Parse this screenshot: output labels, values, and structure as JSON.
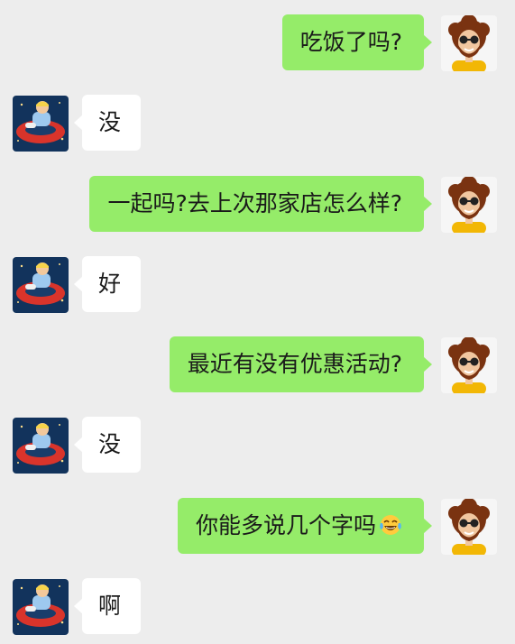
{
  "chat": {
    "messages": [
      {
        "sender": "me",
        "text": "吃饭了吗?"
      },
      {
        "sender": "friend",
        "text": "没"
      },
      {
        "sender": "me",
        "text": "一起吗?去上次那家店怎么样?"
      },
      {
        "sender": "friend",
        "text": "好"
      },
      {
        "sender": "me",
        "text": "最近有没有优惠活动?"
      },
      {
        "sender": "friend",
        "text": "没"
      },
      {
        "sender": "me",
        "text": "你能多说几个字吗",
        "emoji": "tears-of-joy-emoji"
      },
      {
        "sender": "friend",
        "text": "啊"
      }
    ]
  },
  "colors": {
    "background": "#ededed",
    "outgoing_bubble": "#95ec69",
    "incoming_bubble": "#ffffff"
  }
}
